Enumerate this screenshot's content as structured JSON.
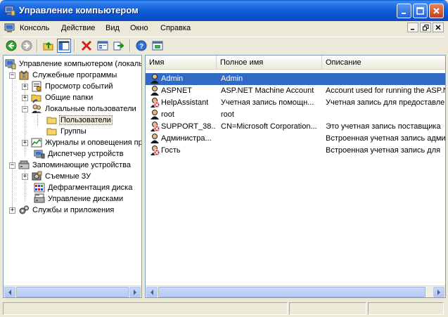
{
  "window": {
    "title": "Управление компьютером"
  },
  "menu": {
    "items": [
      "Консоль",
      "Действие",
      "Вид",
      "Окно",
      "Справка"
    ]
  },
  "tree": {
    "items": [
      {
        "label": "Управление компьютером (локальн",
        "icon": "computer-management-icon"
      },
      {
        "label": "Служебные программы",
        "icon": "tools-icon"
      },
      {
        "label": "Просмотр событий",
        "icon": "event-viewer-icon"
      },
      {
        "label": "Общие папки",
        "icon": "shared-folders-icon"
      },
      {
        "label": "Локальные пользователи",
        "icon": "users-icon"
      },
      {
        "label": "Пользователи",
        "icon": "folder-icon"
      },
      {
        "label": "Группы",
        "icon": "folder-icon"
      },
      {
        "label": "Журналы и оповещения пр",
        "icon": "logs-icon"
      },
      {
        "label": "Диспетчер устройств",
        "icon": "device-manager-icon"
      },
      {
        "label": "Запоминающие устройства",
        "icon": "storage-icon"
      },
      {
        "label": "Съемные ЗУ",
        "icon": "removable-storage-icon"
      },
      {
        "label": "Дефрагментация диска",
        "icon": "defrag-icon"
      },
      {
        "label": "Управление дисками",
        "icon": "disk-management-icon"
      },
      {
        "label": "Службы и приложения",
        "icon": "services-icon"
      }
    ]
  },
  "list": {
    "columns": [
      "Имя",
      "Полное имя",
      "Описание"
    ],
    "rows": [
      {
        "name": "Admin",
        "full_name": "Admin",
        "description": ""
      },
      {
        "name": "ASPNET",
        "full_name": "ASP.NET Machine Account",
        "description": "Account used for running the ASP.N"
      },
      {
        "name": "HelpAssistant",
        "full_name": "Учетная запись помощн...",
        "description": "Учетная запись для предоставле"
      },
      {
        "name": "root",
        "full_name": "root",
        "description": ""
      },
      {
        "name": "SUPPORT_38...",
        "full_name": "CN=Microsoft Corporation...",
        "description": "Это учетная запись поставщика"
      },
      {
        "name": "Администра...",
        "full_name": "",
        "description": "Встроенная учетная запись адми"
      },
      {
        "name": "Гость",
        "full_name": "",
        "description": "Встроенная учетная запись для"
      }
    ]
  },
  "colors": {
    "title_bar": "#0a58d6",
    "selection": "#316ac5",
    "window_bg": "#ece9d8"
  }
}
